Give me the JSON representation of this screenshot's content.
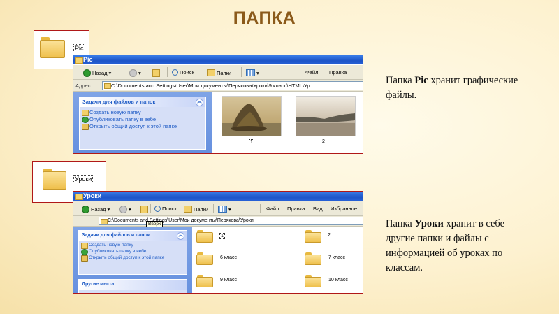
{
  "title": "ПАПКА",
  "pic_icon": {
    "label": "Pic"
  },
  "pic_window": {
    "title": "Pic",
    "toolbar": {
      "back": "Назад",
      "search": "Поиск",
      "folders": "Папки",
      "file": "Файл",
      "edit": "Правка"
    },
    "address_label": "Адрес:",
    "address": "C:\\Documents and Settings\\User\\Мои документы\\Перякова\\Уроки\\9 класс\\HTML\\Ур",
    "tasks_header": "Задачи для файлов и папок",
    "tasks": [
      "Создать новую папку",
      "Опубликовать папку в вебе",
      "Открыть общий доступ к этой папке"
    ],
    "files": [
      {
        "name": "1"
      },
      {
        "name": "2"
      }
    ]
  },
  "uroki_icon": {
    "label": "Уроки"
  },
  "uroki_window": {
    "title": "Уроки",
    "toolbar": {
      "back": "Назад",
      "search": "Поиск",
      "folders": "Папки",
      "file": "Файл",
      "edit": "Правка",
      "view": "Вид",
      "favorites": "Избранное"
    },
    "tooltip": "Вверх",
    "address": "C:\\Documents and Settings\\User\\Мои документы\\Перякова\\Уроки",
    "tasks_header": "Задачи для файлов и папок",
    "tasks": [
      "Создать новую папку",
      "Опубликовать папку в вебе",
      "Открыть общий доступ к этой папке"
    ],
    "other_places": "Другие места",
    "folders": [
      "1",
      "2",
      "6 класс",
      "7 класс",
      "9 класс",
      "10 класс"
    ]
  },
  "desc_pic": {
    "pre": "Папка ",
    "bold": "Pic",
    "post": " хранит графические файлы."
  },
  "desc_uroki": {
    "pre": "Папка ",
    "bold": "Уроки",
    "post": " хранит в себе другие папки и файлы с информацией об уроках по классам."
  },
  "colors": {
    "title": "#8b5a1a",
    "frame": "#b01818",
    "titlebar": "#1d55c8",
    "task_link": "#215dc6"
  }
}
